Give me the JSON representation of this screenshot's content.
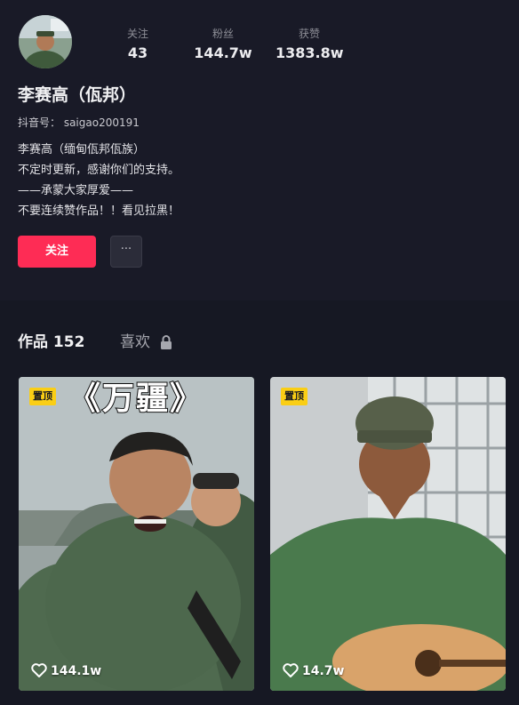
{
  "profile": {
    "avatar_icon": "person-avatar-icon",
    "name": "李赛高（佤邦）",
    "douyin_id": "抖音号：  saigao200191",
    "stats": {
      "following_label": "关注",
      "following_value": "43",
      "fans_label": "粉丝",
      "fans_value": "144.7w",
      "likes_label": "获赞",
      "likes_value": "1383.8w"
    },
    "bio": [
      "李赛高（缅甸佤邦佤族）",
      "不定时更新，感谢你们的支持。",
      "——承蒙大家厚爱——",
      "不要连续赞作品！！看见拉黑！"
    ],
    "follow_label": "关注",
    "more_label": "···"
  },
  "tabs": {
    "works_label": "作品 152",
    "likes_label": "喜欢",
    "likes_icon": "lock-icon"
  },
  "videos": [
    {
      "pin_label": "置顶",
      "title": "《万疆》",
      "like_count": "144.1w",
      "like_icon": "heart-icon"
    },
    {
      "pin_label": "置顶",
      "title": "",
      "like_count": "14.7w",
      "like_icon": "heart-icon"
    }
  ],
  "colors": {
    "background": "#161823",
    "header_background": "#191a27",
    "follow_button": "#fe2c55",
    "pin_badge": "#face15"
  }
}
